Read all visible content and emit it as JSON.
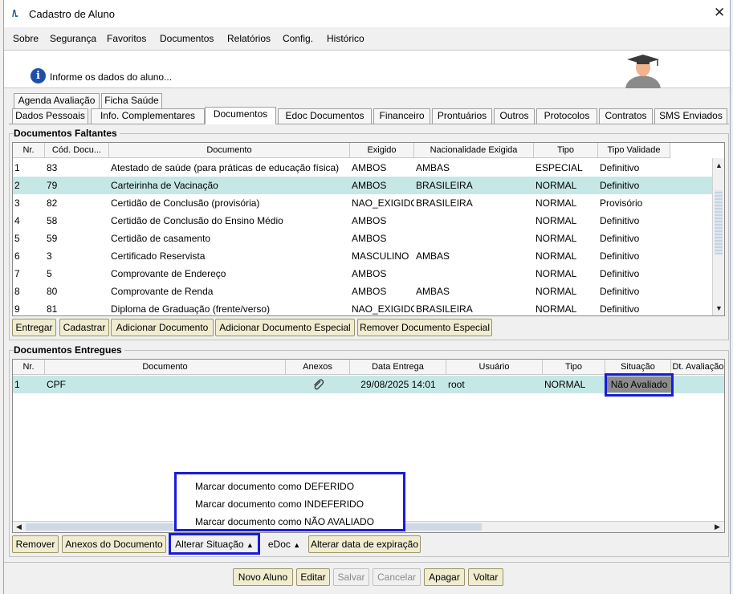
{
  "window": {
    "title": "Cadastro de Aluno",
    "close_label": "✕",
    "logo": "/\\."
  },
  "menu": [
    "Sobre",
    "Segurança",
    "Favoritos",
    "Documentos",
    "Relatórios",
    "Config.",
    "Histórico"
  ],
  "info": {
    "text": "Informe os dados do aluno...",
    "icon": "i"
  },
  "tabs_top": [
    "Agenda Avaliação",
    "Ficha Saúde"
  ],
  "tabs_bottom": [
    "Dados Pessoais",
    "Info. Complementares",
    "Documentos",
    "Edoc Documentos",
    "Financeiro",
    "Prontuários",
    "Outros",
    "Protocolos",
    "Contratos",
    "SMS Enviados"
  ],
  "active_tab": "Documentos",
  "faltantes": {
    "title": "Documentos Faltantes",
    "columns": [
      "Nr.",
      "Cód. Docu...",
      "Documento",
      "Exigido",
      "Nacionalidade Exigida",
      "Tipo",
      "Tipo Validade"
    ],
    "rows": [
      [
        "1",
        "83",
        "Atestado de saúde (para práticas de educação física)",
        "AMBOS",
        "AMBAS",
        "ESPECIAL",
        "Definitivo"
      ],
      [
        "2",
        "79",
        "Carteirinha de Vacinação",
        "AMBOS",
        "BRASILEIRA",
        "NORMAL",
        "Definitivo"
      ],
      [
        "3",
        "82",
        "Certidão de Conclusão (provisória)",
        "NAO_EXIGIDO",
        "BRASILEIRA",
        "NORMAL",
        "Provisório"
      ],
      [
        "4",
        "58",
        "Certidão de Conclusão do Ensino Médio",
        "AMBOS",
        "",
        "NORMAL",
        "Definitivo"
      ],
      [
        "5",
        "59",
        "Certidão de casamento",
        "AMBOS",
        "",
        "NORMAL",
        "Definitivo"
      ],
      [
        "6",
        "3",
        "Certificado Reservista",
        "MASCULINO",
        "AMBAS",
        "NORMAL",
        "Definitivo"
      ],
      [
        "7",
        "5",
        "Comprovante de Endereço",
        "AMBOS",
        "",
        "NORMAL",
        "Definitivo"
      ],
      [
        "8",
        "80",
        "Comprovante de Renda",
        "AMBOS",
        "AMBAS",
        "NORMAL",
        "Definitivo"
      ],
      [
        "9",
        "81",
        "Diploma de Graduação (frente/verso)",
        "NAO_EXIGIDO",
        "BRASILEIRA",
        "NORMAL",
        "Definitivo"
      ]
    ],
    "buttons": [
      "Entregar",
      "Cadastrar",
      "Adicionar Documento",
      "Adicionar Documento Especial",
      "Remover Documento Especial"
    ]
  },
  "entregues": {
    "title": "Documentos Entregues",
    "columns": [
      "Nr.",
      "Documento",
      "Anexos",
      "Data Entrega",
      "Usuário",
      "Tipo",
      "Situação",
      "Dt. Avaliação"
    ],
    "rows": [
      {
        "nr": "1",
        "documento": "CPF",
        "anexo_icon": "paperclip-icon",
        "data": "29/08/2025 14:01",
        "usuario": "root",
        "tipo": "NORMAL",
        "situacao": "Não Avaliado"
      }
    ],
    "buttons": [
      "Remover",
      "Anexos do Documento",
      "Alterar Situação",
      "eDoc",
      "Alterar data de expiração"
    ]
  },
  "dropdown": [
    "Marcar documento como DEFERIDO",
    "Marcar documento como INDEFERIDO",
    "Marcar documento como NÃO AVALIADO"
  ],
  "footer_buttons": [
    "Novo Aluno",
    "Editar",
    "Salvar",
    "Cancelar",
    "Apagar",
    "Voltar"
  ],
  "colors": {
    "selected_row": "#c5e8e6",
    "button": "#f0ecd0",
    "highlight": "#1a1adb"
  }
}
